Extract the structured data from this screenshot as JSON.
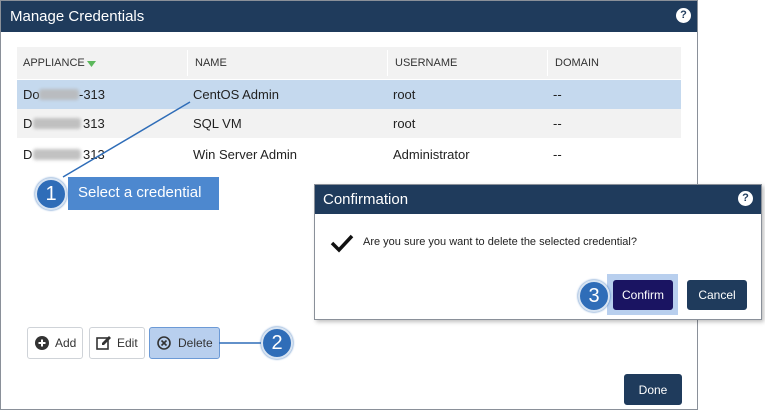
{
  "dialog": {
    "title": "Manage Credentials",
    "help": "?"
  },
  "table": {
    "columns": [
      "APPLIANCE",
      "NAME",
      "USERNAME",
      "DOMAIN"
    ],
    "sort_icon": "sort-down-icon",
    "rows": [
      {
        "appliance_prefix": "Do",
        "appliance_suffix": "-313",
        "name": "CentOS Admin",
        "username": "root",
        "domain": "--",
        "selected": true
      },
      {
        "appliance_prefix": "D",
        "appliance_suffix": "313",
        "name": "SQL VM",
        "username": "root",
        "domain": "--",
        "selected": false
      },
      {
        "appliance_prefix": "D",
        "appliance_suffix": "313",
        "name": "Win Server Admin",
        "username": "Administrator",
        "domain": "--",
        "selected": false
      }
    ]
  },
  "toolbar": {
    "add_label": "Add",
    "edit_label": "Edit",
    "delete_label": "Delete"
  },
  "footer": {
    "done_label": "Done"
  },
  "callouts": {
    "step1": "1",
    "step1_text": "Select a credential",
    "step2": "2",
    "step3": "3"
  },
  "confirmation": {
    "title": "Confirmation",
    "help": "?",
    "message": "Are you sure you want to delete the selected credential?",
    "confirm_label": "Confirm",
    "cancel_label": "Cancel"
  },
  "colors": {
    "titlebar": "#1f3b5c",
    "selected_row": "#c5d9ee",
    "callout": "#2f6db8",
    "callout_box": "#4d88cf",
    "sort_arrow": "#5cb85c"
  }
}
